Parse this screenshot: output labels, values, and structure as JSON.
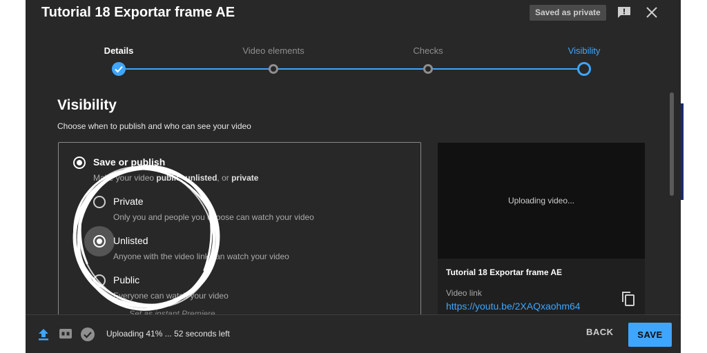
{
  "dialog": {
    "title": "Tutorial 18 Exportar frame AE",
    "saved_badge": "Saved as private",
    "icons": [
      "feedback-icon",
      "close-icon"
    ]
  },
  "steps": [
    {
      "label": "Details",
      "state": "done"
    },
    {
      "label": "Video elements",
      "state": "pending"
    },
    {
      "label": "Checks",
      "state": "pending"
    },
    {
      "label": "Visibility",
      "state": "active"
    }
  ],
  "visibility": {
    "title": "Visibility",
    "subtitle": "Choose when to publish and who can see your video",
    "save_or_publish": {
      "label": "Save or publish",
      "desc_prefix": "Make your video ",
      "desc_public": "public",
      "desc_sep1": ", ",
      "desc_unlisted": "unlisted",
      "desc_sep2": ", or ",
      "desc_private": "private"
    },
    "options": [
      {
        "label": "Private",
        "desc": "Only you and people you choose can watch your video",
        "selected": false
      },
      {
        "label": "Unlisted",
        "desc": "Anyone with the video link can watch your video",
        "selected": true
      },
      {
        "label": "Public",
        "desc": "Everyone can watch your video",
        "selected": false
      }
    ],
    "premiere": "Set as instant Premiere"
  },
  "preview": {
    "status": "Uploading video...",
    "title": "Tutorial 18 Exportar frame AE",
    "link_label": "Video link",
    "link_url": "https://youtu.be/2XAQxaohm64"
  },
  "footer": {
    "status": "Uploading 41% ... 52 seconds left",
    "upload_progress": 0.41,
    "back": "BACK",
    "save": "SAVE"
  },
  "colors": {
    "accent": "#3ea6ff",
    "dialog_bg": "#282828"
  }
}
